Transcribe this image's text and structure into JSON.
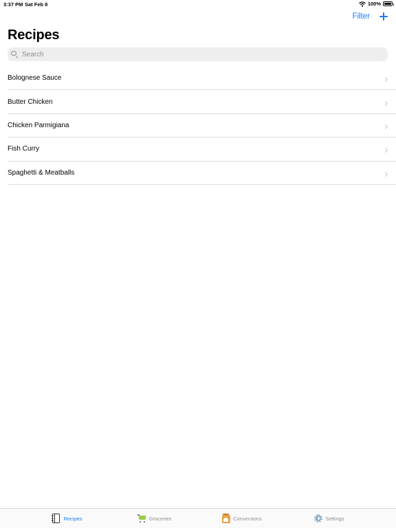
{
  "status_bar": {
    "time": "3:37 PM",
    "date": "Sat Feb 8",
    "battery": "100%",
    "battery_level": 1.0
  },
  "nav": {
    "filter_label": "Filter",
    "add_icon": "plus-icon"
  },
  "page": {
    "title": "Recipes"
  },
  "search": {
    "placeholder": "Search",
    "value": ""
  },
  "recipes": [
    {
      "name": "Bolognese Sauce"
    },
    {
      "name": "Butter Chicken"
    },
    {
      "name": "Chicken Parmigiana"
    },
    {
      "name": "Fish Curry"
    },
    {
      "name": "Spaghetti & Meatballs"
    }
  ],
  "tabs": [
    {
      "label": "Recipes",
      "icon": "notebook-icon",
      "active": true
    },
    {
      "label": "Groceries",
      "icon": "cart-icon",
      "active": false
    },
    {
      "label": "Conversions",
      "icon": "scale-icon",
      "active": false
    },
    {
      "label": "Settings",
      "icon": "gear-icon",
      "active": false
    }
  ],
  "colors": {
    "accent": "#1a7cf2",
    "inactive_tab": "#8e8e93",
    "separator": "#dcdcdf",
    "search_background": "#eeeeef"
  }
}
